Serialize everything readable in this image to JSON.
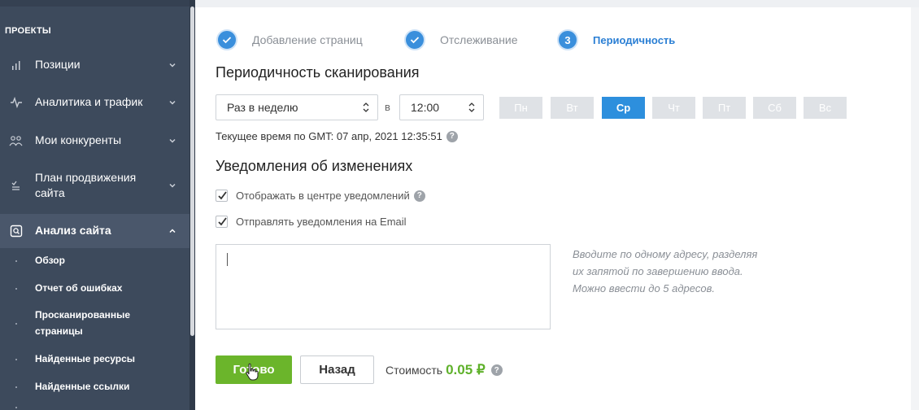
{
  "sidebar": {
    "section_title": "ПРОЕКТЫ",
    "items": [
      {
        "label": "Позиции",
        "icon": "bar-chart-icon"
      },
      {
        "label": "Аналитика и трафик",
        "icon": "pulse-icon"
      },
      {
        "label": "Мои конкуренты",
        "icon": "people-icon"
      },
      {
        "label": "План продвижения\nсайта",
        "line1": "План продвижения",
        "line2": "сайта",
        "icon": "checklist-icon"
      },
      {
        "label": "Анализ сайта",
        "icon": "site-analysis-icon"
      }
    ],
    "subitems": [
      {
        "label": "Обзор"
      },
      {
        "label": "Отчет об ошибках"
      },
      {
        "line1": "Просканированные",
        "line2": "страницы"
      },
      {
        "label": "Найденные ресурсы"
      },
      {
        "label": "Найденные ссылки"
      }
    ]
  },
  "stepper": {
    "steps": [
      {
        "label": "Добавление страниц",
        "state": "done"
      },
      {
        "label": "Отслеживание",
        "state": "done"
      },
      {
        "number": "3",
        "label": "Периодичность",
        "state": "current"
      }
    ]
  },
  "schedule": {
    "heading": "Периодичность сканирования",
    "frequency": "Раз в неделю",
    "at_label": "в",
    "time": "12:00",
    "days": [
      "Пн",
      "Вт",
      "Ср",
      "Чт",
      "Пт",
      "Сб",
      "Вс"
    ],
    "selected_day": "Ср",
    "current_time_note": "Текущее время по GMT: 07 апр, 2021 12:35:51"
  },
  "notifications": {
    "heading": "Уведомления об изменениях",
    "show_in_center": "Отображать в центре уведомлений",
    "send_email": "Отправлять уведомления на Email",
    "hint_line1": "Вводите по одному адресу, разделяя",
    "hint_line2": "их запятой по завершению ввода.",
    "hint_line3": "Можно ввести до 5 адресов.",
    "email_value": ""
  },
  "footer": {
    "done_label": "Готово",
    "back_label": "Назад",
    "cost_label": "Стоимость",
    "cost_value": "0.05 ₽"
  },
  "colors": {
    "accent": "#2d8fdd",
    "success": "#6bb52b",
    "sidebar": "#3d4a5c"
  }
}
